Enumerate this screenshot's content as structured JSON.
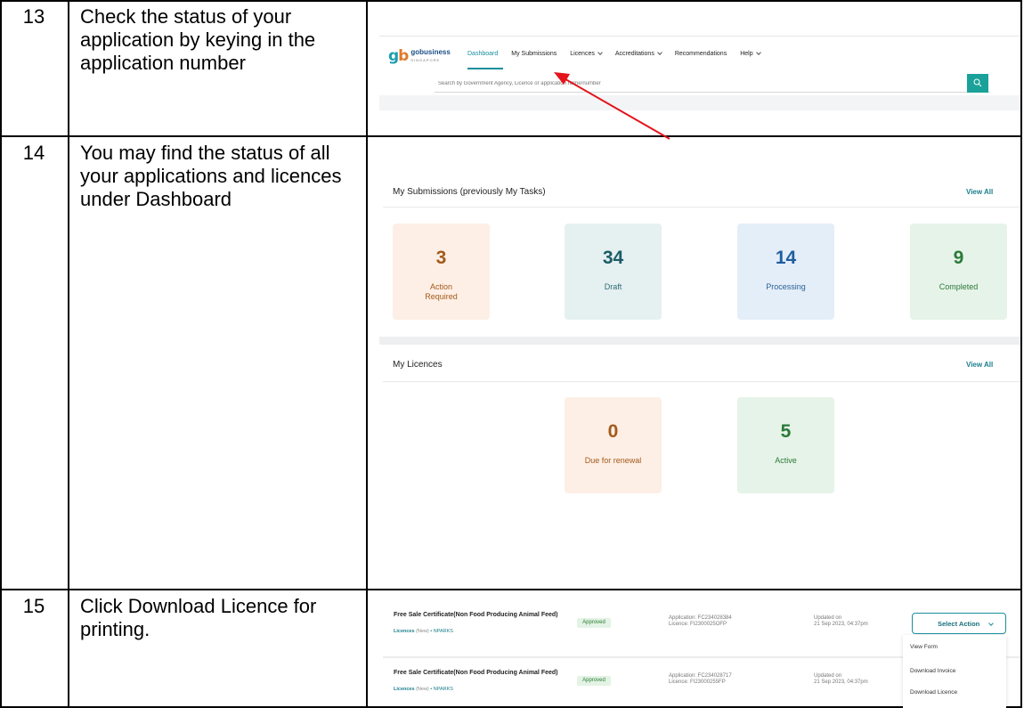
{
  "rows": [
    {
      "number": "13",
      "step": "Check the status of your application by keying in the application number"
    },
    {
      "number": "14",
      "step": "You may find the status of all your applications and licences under Dashboard"
    },
    {
      "number": "15",
      "step": "Click Download Licence for printing."
    }
  ],
  "portal": {
    "logo_mark_left": "g",
    "logo_mark_right": "b",
    "logo_word": "gobusiness",
    "logo_sub": "SINGAPORE",
    "nav": [
      "Dashboard",
      "My Submissions",
      "Licences",
      "Accreditations",
      "Recommendations",
      "Help"
    ],
    "search_placeholder": "Search by Government Agency, Licence or application name/number"
  },
  "dashboard": {
    "submissions_title": "My Submissions (previously My Tasks)",
    "view_all": "View All",
    "submission_cards": [
      {
        "count": "3",
        "label": "Action Required"
      },
      {
        "count": "34",
        "label": "Draft"
      },
      {
        "count": "14",
        "label": "Processing"
      },
      {
        "count": "9",
        "label": "Completed"
      }
    ],
    "licences_title": "My Licences",
    "licence_cards": [
      {
        "count": "0",
        "label": "Due for renewal"
      },
      {
        "count": "5",
        "label": "Active"
      }
    ]
  },
  "records": [
    {
      "title": "Free Sale Certificate(Non Food Producing Animal Feed)",
      "type": "Licences",
      "kind": "(New)",
      "agency": "• NPARKS",
      "status": "Approved",
      "application": "Application: FC234028384",
      "licence": "Licence: FI2300025OFP",
      "updated_label": "Updated on",
      "updated_at": "21 Sep 2023, 04:37pm"
    },
    {
      "title": "Free Sale Certificate(Non Food Producing Animal Feed)",
      "type": "Licences",
      "kind": "(New)",
      "agency": "• NPARKS",
      "status": "Approved",
      "application": "Application: FC234028717",
      "licence": "Licence: FI23000255FP",
      "updated_label": "Updated on",
      "updated_at": "21 Sep 2023, 04:37pm"
    }
  ],
  "select_action": {
    "label": "Select Action",
    "options": [
      "View Form",
      "Download Invoice",
      "Download Licence"
    ]
  },
  "colors": {
    "accent": "#1a8f9c",
    "arrow": "#e3141b"
  }
}
